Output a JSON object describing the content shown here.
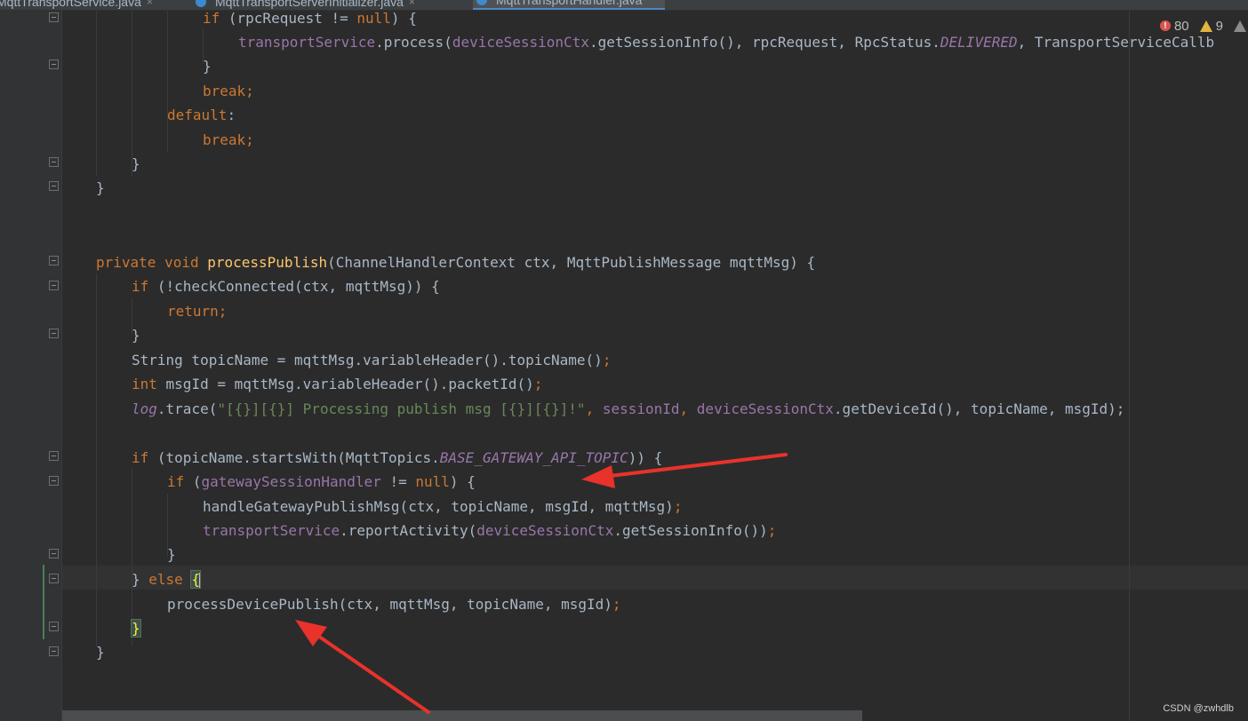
{
  "tabs": [
    {
      "label": "MqttTransportService.java",
      "active": false
    },
    {
      "label": "MqttTransportServerInitializer.java",
      "active": false
    },
    {
      "label": "MqttTransportHandler.java",
      "active": true
    }
  ],
  "inspection": {
    "errors": "80",
    "warnings": "9"
  },
  "code": {
    "l1": {
      "a": "if",
      "b": " (rpcRequest != ",
      "c": "null",
      "d": ") {"
    },
    "l2": {
      "a": "transportService",
      "b": ".process(",
      "c": "deviceSessionCtx",
      "d": ".getSessionInfo(), rpcRequest, RpcStatus.",
      "e": "DELIVERED",
      "f": ", TransportServiceCallb"
    },
    "l3": "}",
    "l4": "break;",
    "l5": "default",
    "l5b": ":",
    "l6": "break;",
    "l7": "}",
    "l8": "}",
    "l11": {
      "a": "private void ",
      "b": "processPublish",
      "c": "(ChannelHandlerContext ctx, MqttPublishMessage mqttMsg) {"
    },
    "l12": {
      "a": "if",
      "b": " (!checkConnected(ctx, mqttMsg)) {"
    },
    "l13": "return;",
    "l14": "}",
    "l15": {
      "a": "String topicName = mqttMsg.variableHeader().topicName()",
      "b": ";"
    },
    "l16": {
      "a": "int",
      "b": " msgId = mqttMsg.variableHeader().packetId()",
      "c": ";"
    },
    "l17": {
      "a": "log",
      "b": ".trace(",
      "c": "\"[{}][{}] Processing publish msg [{}][{}]!\"",
      "d": ", ",
      "e": "sessionId",
      "f": ", ",
      "g": "deviceSessionCtx",
      "h": ".getDeviceId(), topicName, msgId);"
    },
    "l19": {
      "a": "if",
      "b": " (topicName.startsWith(MqttTopics.",
      "c": "BASE_GATEWAY_API_TOPIC",
      "d": ")) {"
    },
    "l20": {
      "a": "if",
      "b": " (",
      "c": "gatewaySessionHandler",
      "d": " != ",
      "e": "null",
      "f": ") {"
    },
    "l21": {
      "a": "handleGatewayPublishMsg(ctx, topicName, msgId, mqttMsg)",
      "b": ";"
    },
    "l22": {
      "a": "transportService",
      "b": ".reportActivity(",
      "c": "deviceSessionCtx",
      "d": ".getSessionInfo())",
      "e": ";"
    },
    "l23": "}",
    "l24": {
      "a": "} ",
      "b": "else",
      "c": " ",
      "d": "{"
    },
    "l25": {
      "a": "processDevicePublish(ctx, mqttMsg, topicName, msgId)",
      "b": ";"
    },
    "l26": "}",
    "l27": "}"
  },
  "watermark": "CSDN @zwhdlb",
  "colors": {
    "background": "#2b2b2b",
    "keyword": "#cc7832",
    "method": "#ffc66d",
    "field": "#9876aa",
    "string": "#6a8759",
    "annotation_arrow": "#e8322b"
  }
}
